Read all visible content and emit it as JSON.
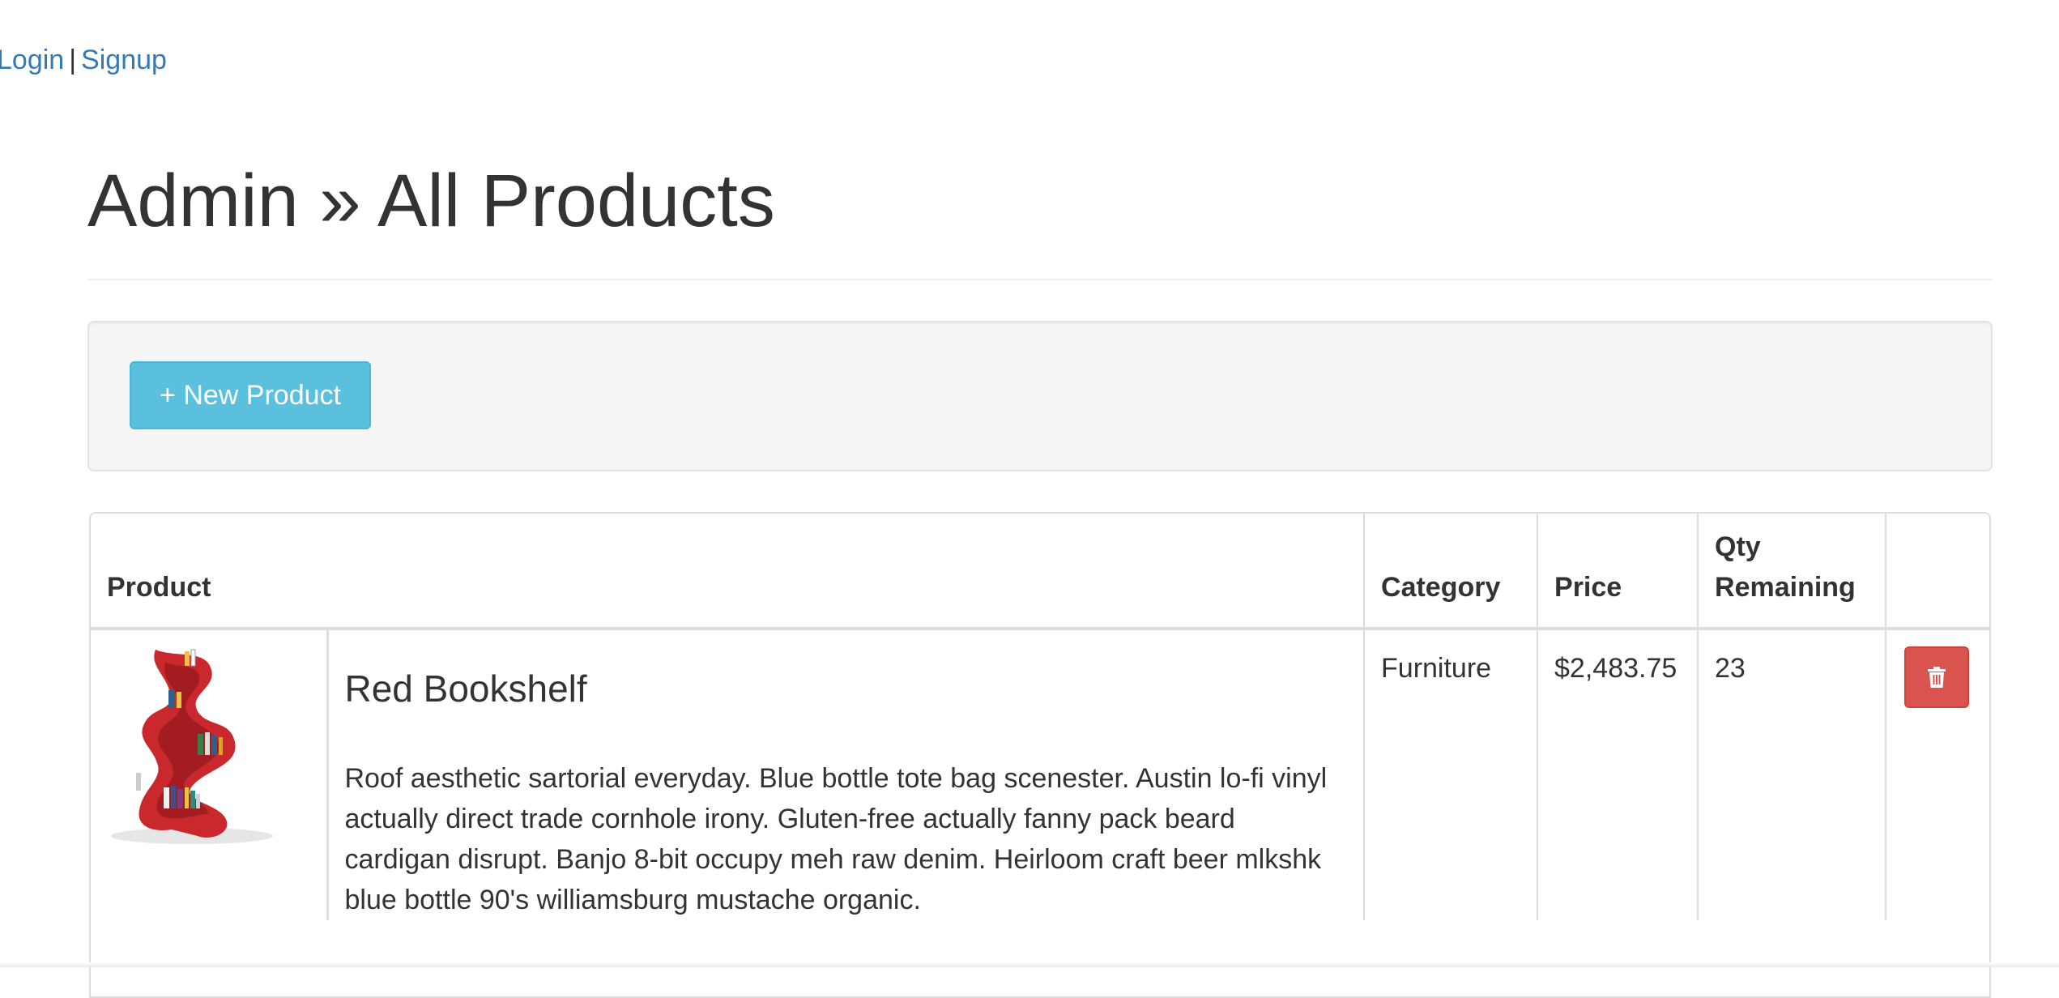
{
  "nav": {
    "login_label": "Login",
    "separator": "|",
    "signup_label": "Signup"
  },
  "page": {
    "title": "Admin » All Products"
  },
  "toolbar": {
    "new_product_label": "+ New Product"
  },
  "table": {
    "headers": {
      "product": "Product",
      "category": "Category",
      "price": "Price",
      "qty": "Qty Remaining"
    },
    "rows": [
      {
        "name": "Red Bookshelf",
        "description": "Roof aesthetic sartorial everyday. Blue bottle tote bag scenester. Austin lo-fi vinyl actually direct trade cornhole irony. Gluten-free actually fanny pack beard cardigan disrupt. Banjo 8-bit occupy meh raw denim. Heirloom craft beer mlkshk blue bottle 90's williamsburg mustache organic.",
        "category": "Furniture",
        "price": "$2,483.75",
        "qty": "23",
        "image_icon": "red-bookshelf-image",
        "delete_icon": "trash-icon"
      }
    ]
  },
  "colors": {
    "link": "#337ab7",
    "info_button": "#5bc0de",
    "danger_button": "#d9534f",
    "well_bg": "#f5f5f5",
    "border": "#dddddd"
  }
}
